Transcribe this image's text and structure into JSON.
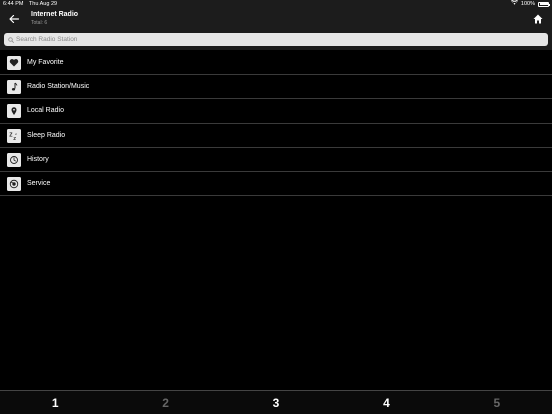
{
  "status_bar": {
    "time": "6:44 PM",
    "date": "Thu Aug 29",
    "battery": "100%"
  },
  "nav": {
    "title": "Internet Radio",
    "subtitle": "Total: 6",
    "back_icon": "arrow-left-icon",
    "home_icon": "home-icon"
  },
  "search": {
    "placeholder": "Search Radio Station"
  },
  "menu": {
    "items": [
      {
        "label": "My Favorite",
        "icon": "heart-icon"
      },
      {
        "label": "Radio Station/Music",
        "icon": "music-note-icon"
      },
      {
        "label": "Local Radio",
        "icon": "location-pin-icon"
      },
      {
        "label": "Sleep Radio",
        "icon": "sleep-zz-icon"
      },
      {
        "label": "History",
        "icon": "history-clock-icon"
      },
      {
        "label": "Service",
        "icon": "service-globe-icon"
      }
    ]
  },
  "tabs": {
    "items": [
      {
        "label": "1",
        "active": true
      },
      {
        "label": "2",
        "active": false
      },
      {
        "label": "3",
        "active": true
      },
      {
        "label": "4",
        "active": true
      },
      {
        "label": "5",
        "active": false
      }
    ]
  },
  "colors": {
    "background": "#000000",
    "bar": "#1c1c1c",
    "divider": "#3a3a3a",
    "tab_inactive": "#666666"
  }
}
